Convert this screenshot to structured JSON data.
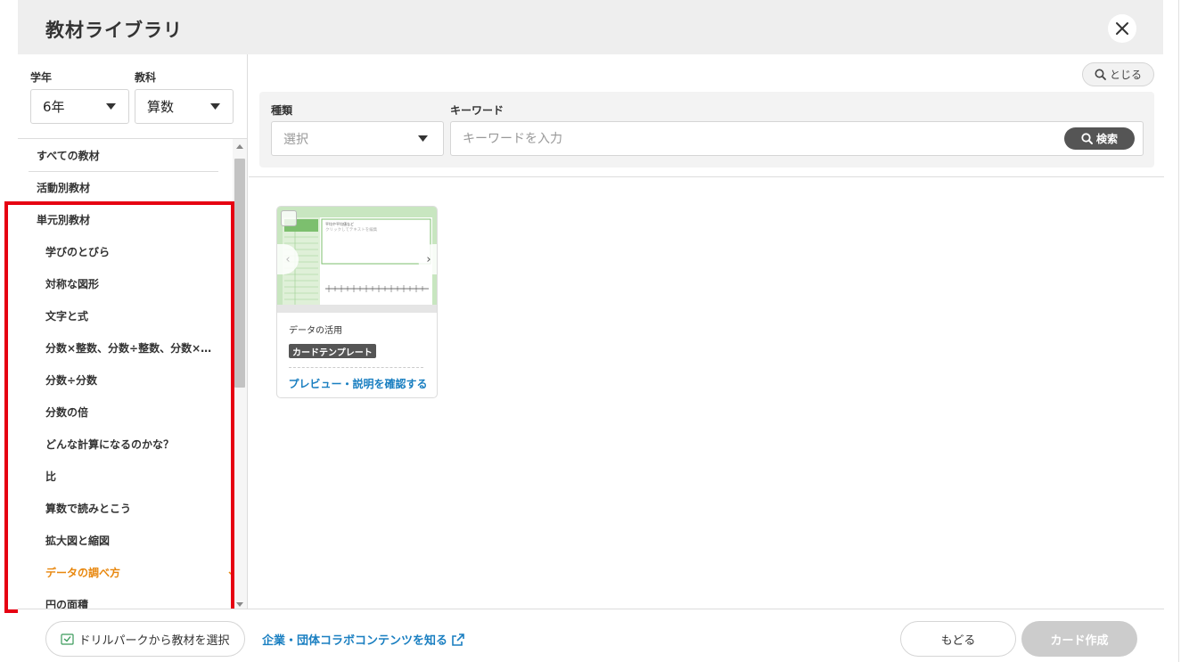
{
  "header": {
    "title": "教材ライブラリ",
    "close_icon": "close-icon"
  },
  "filters": {
    "grade_label": "学年",
    "grade_value": "6年",
    "subject_label": "教科",
    "subject_value": "算数"
  },
  "material_list": {
    "items": [
      {
        "label": "すべての教材",
        "level": "top"
      },
      {
        "label": "活動別教材",
        "level": "top"
      },
      {
        "label": "単元別教材",
        "level": "top"
      },
      {
        "label": "学びのとびら",
        "level": "sub"
      },
      {
        "label": "対称な図形",
        "level": "sub"
      },
      {
        "label": "文字と式",
        "level": "sub"
      },
      {
        "label": "分数×整数、分数÷整数、分数×…",
        "level": "sub"
      },
      {
        "label": "分数÷分数",
        "level": "sub"
      },
      {
        "label": "分数の倍",
        "level": "sub"
      },
      {
        "label": "どんな計算になるのかな？",
        "level": "sub"
      },
      {
        "label": "比",
        "level": "sub"
      },
      {
        "label": "算数で読みとこう",
        "level": "sub"
      },
      {
        "label": "拡大図と縮図",
        "level": "sub"
      },
      {
        "label": "データの調べ方",
        "level": "sub",
        "selected": true
      },
      {
        "label": "円の面積",
        "level": "sub"
      }
    ],
    "active_color": "#e8870e",
    "highlight_color": "#e60012"
  },
  "search": {
    "toggle_label": "とじる",
    "type_label": "種類",
    "type_placeholder": "選択",
    "keyword_label": "キーワード",
    "keyword_placeholder": "キーワードを入力",
    "search_button": "検索"
  },
  "cards": [
    {
      "name": "データの活用",
      "tag": "カードテンプレート",
      "link": "プレビュー・説明を確認する",
      "thumb_caption": "平均や平均値など",
      "thumb_hint": "クリックしてテキストを編集"
    }
  ],
  "footer": {
    "drill_button": "ドリルパークから教材を選択",
    "collab_link": "企業・団体コラボコンテンツを知る",
    "back_button": "もどる",
    "create_button": "カード作成"
  },
  "colors": {
    "accent_blue": "#1a7fc1",
    "dark_button": "#555555",
    "disabled": "#cccccc"
  }
}
